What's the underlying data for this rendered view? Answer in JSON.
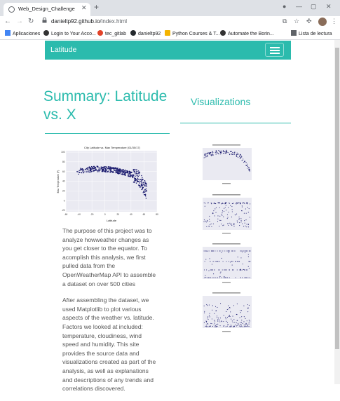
{
  "browser": {
    "tab_title": "Web_Design_Challenge",
    "url_domain": "danieltp92.github.io",
    "url_path": "/index.html",
    "bookmarks": [
      "Aplicaciones",
      "Login to Your Acco...",
      "tec_gitlab",
      "danieltp92",
      "Python Courses & T...",
      "Automate the Borin..."
    ],
    "reading_list": "Lista de lectura"
  },
  "navbar": {
    "brand": "Latitude"
  },
  "summary": {
    "title": "Summary: Latitude vs. X",
    "paragraph1": "The purpose of this project was to analyze howweather changes as you get closer to the equator. To acomplish this analysis, we first pulled data from the OpenWeatherMap API to assemble a dataset on over 500 cities",
    "paragraph2": "After assembling the dataset, we used Matplotlib to plot various aspects of the weather vs. latitude. Factors we looked at included: temperature, cloudiness, wind speed and humidity. This site provides the source data and visualizations created as part of the analysis, as well as explanations and descriptions of any trends and correlations discovered."
  },
  "visualizations": {
    "title": "Visualizations"
  },
  "main_chart": {
    "title": "City Latitude vs. Max Temperature (01/30/17)",
    "xlabel": "Latitude",
    "ylabel": "Max Temperature (F)",
    "xticks": [
      "-60",
      "-40",
      "-20",
      "0",
      "20",
      "40",
      "60",
      "80"
    ],
    "yticks": [
      "100",
      "80",
      "60",
      "40",
      "20",
      "0",
      "-20"
    ]
  },
  "colors": {
    "teal": "#2bbbad",
    "dot": "#1a1a6e",
    "plot_bg": "#eaeaf2"
  }
}
